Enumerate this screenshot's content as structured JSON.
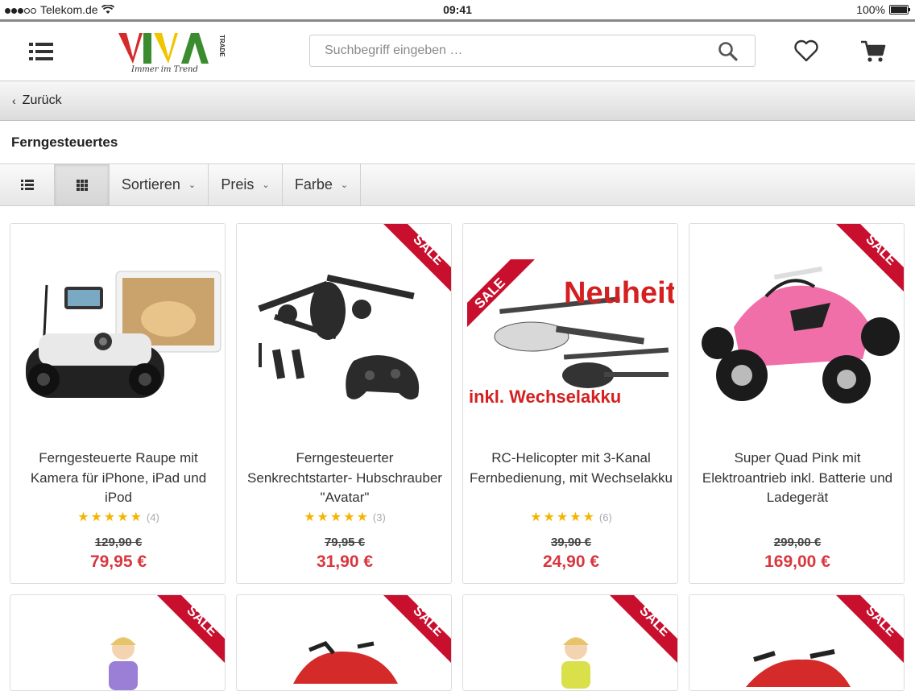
{
  "status": {
    "carrier": "Telekom.de",
    "time": "09:41",
    "battery": "100%"
  },
  "header": {
    "logo_text": "VIVA",
    "logo_tagline": "Immer im Trend",
    "logo_trade": "TRADE",
    "search_placeholder": "Suchbegriff eingeben …"
  },
  "nav": {
    "back_label": "Zurück"
  },
  "page": {
    "title": "Ferngesteuertes"
  },
  "toolbar": {
    "sort_label": "Sortieren",
    "price_label": "Preis",
    "color_label": "Farbe"
  },
  "products": [
    {
      "name": "Ferngesteuerte Raupe mit Kamera für iPhone, iPad und iPod",
      "rating_count": "(4)",
      "old_price": "129,90 €",
      "price": "79,95 €",
      "sale": false
    },
    {
      "name": "Ferngesteuerter Senkrechtstarter- Hubschrauber \"Avatar\"",
      "rating_count": "(3)",
      "old_price": "79,95 €",
      "price": "31,90 €",
      "sale": true
    },
    {
      "name": "RC-Helicopter mit 3-Kanal Fernbedienung, mit Wechselakku",
      "rating_count": "(6)",
      "old_price": "39,90 €",
      "price": "24,90 €",
      "sale": true,
      "badge_text": "Neuheit",
      "caption_text": "inkl. Wechselakku"
    },
    {
      "name": "Super Quad Pink mit Elektroantrieb inkl. Batterie und Ladegerät",
      "rating_count": "",
      "old_price": "299,00 €",
      "price": "169,00 €",
      "sale": true
    }
  ],
  "sale_label": "SALE",
  "stars": "★★★★★",
  "colors": {
    "price_red": "#d9363e",
    "star_yellow": "#f4b400",
    "ribbon_red": "#c8102e"
  }
}
